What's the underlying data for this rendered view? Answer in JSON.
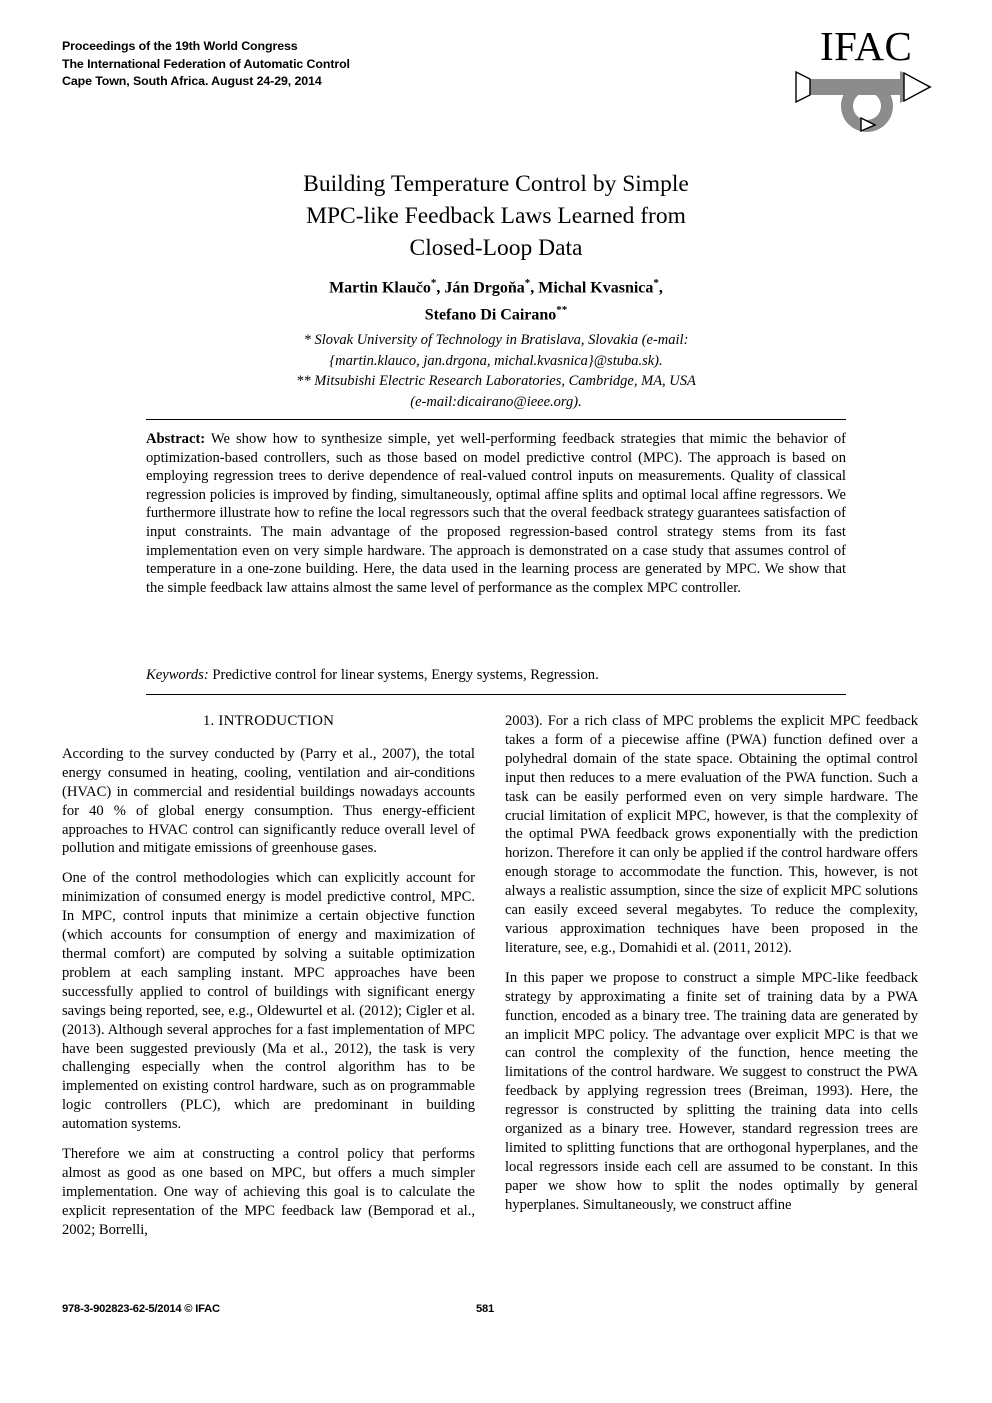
{
  "header": {
    "masthead": [
      "Proceedings of the 19th World Congress",
      "The International Federation of Automatic Control",
      "Cape Town, South Africa. August 24-29, 2014"
    ],
    "logo_text": "IFAC"
  },
  "title": {
    "line1": "Building Temperature Control by Simple",
    "line2": "MPC-like Feedback Laws Learned from",
    "line3": "Closed-Loop Data"
  },
  "authors": {
    "line1_a": "Martin Klaučo",
    "line1_mark_a": "*",
    "line1_b": ", Ján Drgoňa",
    "line1_mark_b": "*",
    "line1_c": ", Michal Kvasnica",
    "line1_mark_c": "*",
    "line1_d": ",",
    "line2_a": "Stefano Di Cairano",
    "line2_mark": "**"
  },
  "affiliations": [
    "* Slovak University of Technology in Bratislava, Slovakia (e-mail:",
    "{martin.klauco, jan.drgona, michal.kvasnica}@stuba.sk).",
    "** Mitsubishi Electric Research Laboratories, Cambridge, MA, USA",
    "(e-mail:dicairano@ieee.org)."
  ],
  "abstract": {
    "label": "Abstract:",
    "body": " We show how to synthesize simple, yet well-performing feedback strategies that mimic the behavior of optimization-based controllers, such as those based on model predictive control (MPC). The approach is based on employing regression trees to derive dependence of real-valued control inputs on measurements. Quality of classical regression policies is improved by finding, simultaneously, optimal affine splits and optimal local affine regressors. We furthermore illustrate how to refine the local regressors such that the overal feedback strategy guarantees satisfaction of input constraints. The main advantage of the proposed regression-based control strategy stems from its fast implementation even on very simple hardware. The approach is demonstrated on a case study that assumes control of temperature in a one-zone building. Here, the data used in the learning process are generated by MPC. We show that the simple feedback law attains almost the same level of performance as the complex MPC controller."
  },
  "keywords": {
    "label": "Keywords:",
    "body": " Predictive control for linear systems, Energy systems, Regression."
  },
  "left_column": {
    "section_heading": "1. INTRODUCTION",
    "paragraphs": [
      "According to the survey conducted by (Parry et al., 2007), the total energy consumed in heating, cooling, ventilation and air-conditions (HVAC) in commercial and residential buildings nowadays accounts for 40 % of global energy consumption. Thus energy-efficient approaches to HVAC control can significantly reduce overall level of pollution and mitigate emissions of greenhouse gases.",
      "One of the control methodologies which can explicitly account for minimization of consumed energy is model predictive control, MPC. In MPC, control inputs that minimize a certain objective function (which accounts for consumption of energy and maximization of thermal comfort) are computed by solving a suitable optimization problem at each sampling instant. MPC approaches have been successfully applied to control of buildings with significant energy savings being reported, see, e.g., Oldewurtel et al. (2012); Cigler et al. (2013). Although several approches for a fast implementation of MPC have been suggested previously (Ma et al., 2012), the task is very challenging especially when the control algorithm has to be implemented on existing control hardware, such as on programmable logic controllers (PLC), which are predominant in building automation systems.",
      "Therefore we aim at constructing a control policy that performs almost as good as one based on MPC, but offers a much simpler implementation. One way of achieving this goal is to calculate the explicit representation of the MPC feedback law (Bemporad et al., 2002; Borrelli,"
    ]
  },
  "right_column": {
    "paragraphs": [
      "2003). For a rich class of MPC problems the explicit MPC feedback takes a form of a piecewise affine (PWA) function defined over a polyhedral domain of the state space. Obtaining the optimal control input then reduces to a mere evaluation of the PWA function. Such a task can be easily performed even on very simple hardware. The crucial limitation of explicit MPC, however, is that the complexity of the optimal PWA feedback grows exponentially with the prediction horizon. Therefore it can only be applied if the control hardware offers enough storage to accommodate the function. This, however, is not always a realistic assumption, since the size of explicit MPC solutions can easily exceed several megabytes. To reduce the complexity, various approximation techniques have been proposed in the literature, see, e.g., Domahidi et al. (2011, 2012).",
      "In this paper we propose to construct a simple MPC-like feedback strategy by approximating a finite set of training data by a PWA function, encoded as a binary tree. The training data are generated by an implicit MPC policy. The advantage over explicit MPC is that we can control the complexity of the function, hence meeting the limitations of the control hardware. We suggest to construct the PWA feedback by applying regression trees (Breiman, 1993). Here, the regressor is constructed by splitting the training data into cells organized as a binary tree. However, standard regression trees are limited to splitting functions that are orthogonal hyperplanes, and the local regressors inside each cell are assumed to be constant. In this paper we show how to split the nodes optimally by general hyperplanes. Simultaneously, we construct affine"
    ]
  },
  "footer": {
    "isbn": "978-3-902823-62-5/2014 © IFAC",
    "page_number": "581"
  },
  "colors": {
    "text": "#000000",
    "background": "#ffffff",
    "logo_gray": "#8c8c8c"
  }
}
